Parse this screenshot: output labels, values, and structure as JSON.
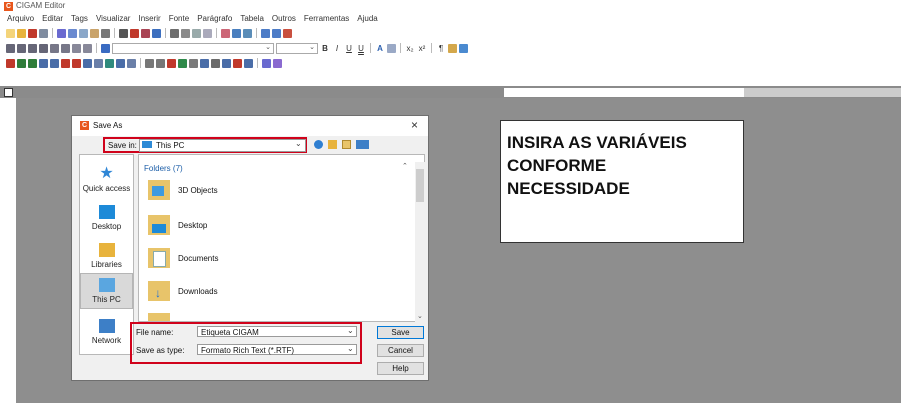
{
  "app": {
    "title": "CIGAM Editor",
    "logo": "C"
  },
  "menu": [
    "Arquivo",
    "Editar",
    "Tags",
    "Visualizar",
    "Inserir",
    "Fonte",
    "Parágrafo",
    "Tabela",
    "Outros",
    "Ferramentas",
    "Ajuda"
  ],
  "toolbar": {
    "format_buttons": [
      "B",
      "I",
      "U",
      "U",
      "A",
      "x₂",
      "x²",
      "¶"
    ],
    "font_combo_value": "",
    "size_combo_value": ""
  },
  "label_page": {
    "lines": [
      "INSIRA AS VARIÁVEIS",
      "CONFORME",
      "NECESSIDADE"
    ]
  },
  "dialog": {
    "title": "Save As",
    "close": "×",
    "save_in_label": "Save in:",
    "save_in_value": "This PC",
    "places": [
      "Quick access",
      "Desktop",
      "Libraries",
      "This PC",
      "Network"
    ],
    "folders_header": "Folders (7)",
    "folders": [
      "3D Objects",
      "Desktop",
      "Documents",
      "Downloads"
    ],
    "file_name_label": "File name:",
    "file_name_value": "Etiqueta CIGAM",
    "save_type_label": "Save as type:",
    "save_type_value": "Formato Rich Text (*.RTF)",
    "buttons": {
      "save": "Save",
      "cancel": "Cancel",
      "help": "Help"
    }
  },
  "colors": {
    "accent_red": "#d0021b",
    "app_orange": "#e8561c",
    "workspace_gray": "#8e8e8e"
  }
}
